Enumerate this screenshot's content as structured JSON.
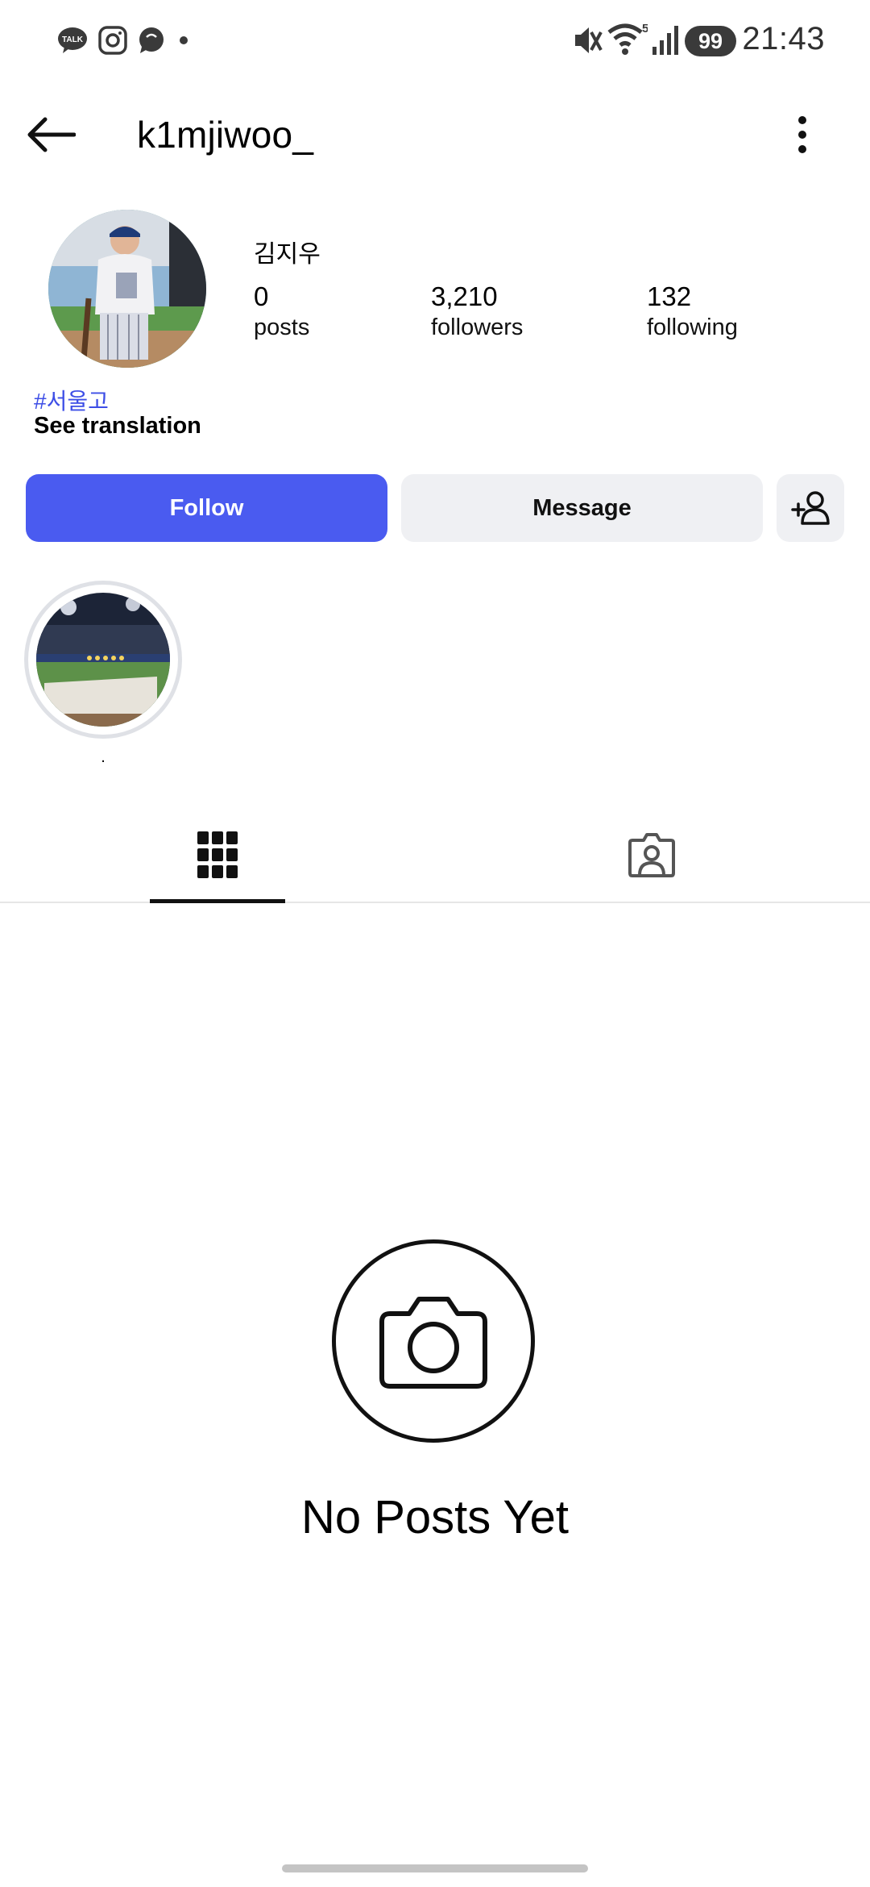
{
  "status_bar": {
    "time": "21:43",
    "battery": "99",
    "signal_network": "5",
    "left_icons": [
      "talk-icon",
      "instagram-icon",
      "chat-bubble-icon",
      "dot-icon"
    ],
    "talk_label": "TALK",
    "right_icons": [
      "mute-icon",
      "wifi-icon",
      "signal-icon",
      "battery-icon"
    ]
  },
  "header": {
    "username": "k1mjiwoo_"
  },
  "profile": {
    "full_name": "김지우",
    "stats": [
      {
        "value": "0",
        "label": "posts"
      },
      {
        "value": "3,210",
        "label": "followers"
      },
      {
        "value": "132",
        "label": "following"
      }
    ],
    "bio_hashtag": "#서울고",
    "see_translation": "See translation"
  },
  "actions": {
    "follow": "Follow",
    "message": "Message"
  },
  "highlights": [
    {
      "label": "."
    }
  ],
  "tabs": [
    "grid-icon",
    "tagged-icon"
  ],
  "empty_state": {
    "title": "No Posts Yet"
  },
  "colors": {
    "accent": "#4a5bf0",
    "hashtag": "#3d4ee6",
    "secondary_button": "#eff0f3"
  }
}
